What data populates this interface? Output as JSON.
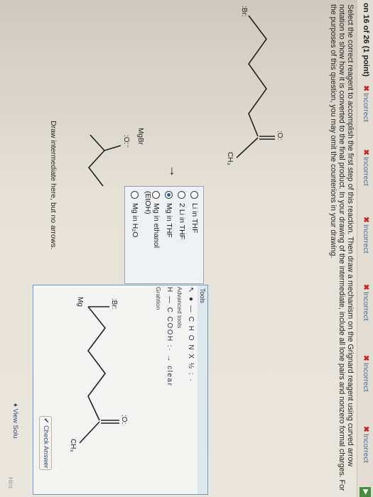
{
  "question": {
    "number": "on 16 of 26 (1 point)",
    "attempts": [
      "Incorrect",
      "Incorrect",
      "Incorrect",
      "Incorrect",
      "Incorrect",
      "Incorrect"
    ],
    "text": "Select the correct reagent to accomplish the first step of this reaction. Then draw a mechanism on the Grignard reagent using curved arrow notation to show how it is converted to the final product. In your drawing of the intermediate, include all lone pairs and nonzero formal charges. For the purposes of this question, you may omit the counterions in your drawing."
  },
  "reagents": {
    "options": [
      "Li in THF",
      "2 Li in THF",
      "Mg in THF",
      "Mg in ethanol (EtOH)",
      "Mg in H₂O"
    ],
    "selected_index": 2
  },
  "molecule_labels": {
    "halogen": ":Br:",
    "carbonyl_o": ":O:",
    "methyl": "CH₃",
    "mg_label": "MgBr",
    "oxygen_anion": ":O:⁻",
    "canvas_halogen": ":Br:",
    "canvas_mg": "Mg",
    "canvas_carbonyl_o": ":O:",
    "canvas_methyl": "CH₃"
  },
  "draw_instruction": "Draw intermediate here, but no arrows.",
  "tools": {
    "header": "Tools",
    "row1": "C H O N X ½ :  ·",
    "adv_label": "Advanced tools",
    "row2": "H  —  C  COOH  :·  →  clear",
    "caption": "Grahtion"
  },
  "buttons": {
    "check": "Check Answer",
    "view": "View Solu",
    "hint": "Hint"
  }
}
